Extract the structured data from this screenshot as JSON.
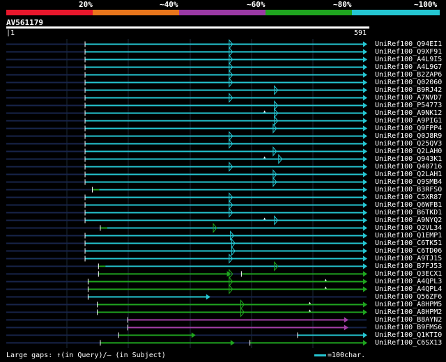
{
  "quality_scale": {
    "labels": [
      "20%",
      "~40%",
      "~60%",
      "~80%",
      "~100%"
    ],
    "colors": [
      "#e8172c",
      "#e8761c",
      "#9b3aa5",
      "#1fa51f",
      "#25c6d2"
    ]
  },
  "query": {
    "accession": "AV561179",
    "start_label": "1",
    "end_label": "591",
    "length": 591
  },
  "hits": [
    {
      "name": "UniRef100_Q94EI1",
      "color": "cyan",
      "segments": [
        [
          130,
          591
        ]
      ],
      "insertions": [
        [
          366,
          "q"
        ]
      ],
      "dots": []
    },
    {
      "name": "UniRef100_Q9XF91",
      "color": "cyan",
      "segments": [
        [
          130,
          591
        ]
      ],
      "insertions": [
        [
          366,
          "q"
        ]
      ],
      "dots": []
    },
    {
      "name": "UniRef100_A4L9I5",
      "color": "cyan",
      "segments": [
        [
          130,
          591
        ]
      ],
      "insertions": [
        [
          366,
          "q"
        ]
      ],
      "dots": []
    },
    {
      "name": "UniRef100_A4L9G7",
      "color": "cyan",
      "segments": [
        [
          130,
          591
        ]
      ],
      "insertions": [
        [
          366,
          "q"
        ]
      ],
      "dots": []
    },
    {
      "name": "UniRef100_B2ZAP6",
      "color": "cyan",
      "segments": [
        [
          130,
          591
        ]
      ],
      "insertions": [
        [
          366,
          "q"
        ]
      ],
      "dots": []
    },
    {
      "name": "UniRef100_Q02060",
      "color": "cyan",
      "segments": [
        [
          130,
          591
        ]
      ],
      "insertions": [
        [
          366,
          "q"
        ]
      ],
      "dots": []
    },
    {
      "name": "UniRef100_B9RJ42",
      "color": "cyan",
      "segments": [
        [
          130,
          591
        ]
      ],
      "insertions": [
        [
          440,
          "q"
        ]
      ],
      "dots": []
    },
    {
      "name": "UniRef100_A7NVD7",
      "color": "cyan",
      "segments": [
        [
          130,
          591
        ]
      ],
      "insertions": [
        [
          366,
          "q"
        ]
      ],
      "dots": []
    },
    {
      "name": "UniRef100_P54773",
      "color": "cyan",
      "segments": [
        [
          130,
          591
        ]
      ],
      "insertions": [
        [
          440,
          "q"
        ]
      ],
      "dots": []
    },
    {
      "name": "UniRef100_A9NK12",
      "color": "cyan",
      "segments": [
        [
          130,
          591
        ]
      ],
      "insertions": [
        [
          440,
          "q"
        ]
      ],
      "dots": [
        [
          424,
          "s"
        ]
      ]
    },
    {
      "name": "UniRef100_A9PIG1",
      "color": "cyan",
      "segments": [
        [
          130,
          591
        ]
      ],
      "insertions": [
        [
          440,
          "q"
        ]
      ],
      "dots": []
    },
    {
      "name": "UniRef100_Q9FPP4",
      "color": "cyan",
      "segments": [
        [
          130,
          591
        ]
      ],
      "insertions": [
        [
          438,
          "q"
        ]
      ],
      "dots": []
    },
    {
      "name": "UniRef100_Q0J8R9",
      "color": "cyan",
      "segments": [
        [
          130,
          591
        ]
      ],
      "insertions": [
        [
          366,
          "q"
        ]
      ],
      "dots": []
    },
    {
      "name": "UniRef100_Q25QV3",
      "color": "cyan",
      "segments": [
        [
          130,
          591
        ]
      ],
      "insertions": [
        [
          366,
          "q"
        ]
      ],
      "dots": []
    },
    {
      "name": "UniRef100_Q2LAH0",
      "color": "cyan",
      "segments": [
        [
          130,
          591
        ]
      ],
      "insertions": [
        [
          438,
          "q"
        ]
      ],
      "dots": []
    },
    {
      "name": "UniRef100_Q943K1",
      "color": "cyan",
      "segments": [
        [
          130,
          591
        ]
      ],
      "insertions": [
        [
          447,
          "q"
        ]
      ],
      "dots": [
        [
          424,
          "s"
        ]
      ]
    },
    {
      "name": "UniRef100_Q40716",
      "color": "cyan",
      "segments": [
        [
          130,
          591
        ]
      ],
      "insertions": [
        [
          366,
          "q"
        ]
      ],
      "dots": []
    },
    {
      "name": "UniRef100_Q2LAH1",
      "color": "cyan",
      "segments": [
        [
          130,
          591
        ]
      ],
      "insertions": [
        [
          438,
          "q"
        ]
      ],
      "dots": []
    },
    {
      "name": "UniRef100_Q9SMB4",
      "color": "cyan",
      "segments": [
        [
          130,
          591
        ]
      ],
      "insertions": [
        [
          438,
          "q"
        ]
      ],
      "dots": []
    },
    {
      "name": "UniRef100_B3RFS0",
      "color": "green_cyan",
      "segments": [
        [
          142,
          591
        ]
      ],
      "insertions": [],
      "dots": []
    },
    {
      "name": "UniRef100_C5XR87",
      "color": "cyan",
      "segments": [
        [
          130,
          591
        ]
      ],
      "insertions": [
        [
          366,
          "q"
        ]
      ],
      "dots": []
    },
    {
      "name": "UniRef100_Q6WFB1",
      "color": "cyan",
      "segments": [
        [
          130,
          591
        ]
      ],
      "insertions": [
        [
          366,
          "q"
        ]
      ],
      "dots": []
    },
    {
      "name": "UniRef100_B6TKD1",
      "color": "cyan",
      "segments": [
        [
          130,
          591
        ]
      ],
      "insertions": [
        [
          366,
          "q"
        ]
      ],
      "dots": []
    },
    {
      "name": "UniRef100_A9NYQ2",
      "color": "cyan",
      "segments": [
        [
          130,
          591
        ]
      ],
      "insertions": [
        [
          440,
          "q"
        ]
      ],
      "dots": [
        [
          424,
          "s"
        ]
      ]
    },
    {
      "name": "UniRef100_Q2VL34",
      "color": "green_cyan",
      "segments": [
        [
          155,
          591
        ]
      ],
      "insertions": [
        [
          340,
          "q"
        ]
      ],
      "dots": []
    },
    {
      "name": "UniRef100_Q1EMP1",
      "color": "cyan",
      "segments": [
        [
          130,
          591
        ]
      ],
      "insertions": [
        [
          368,
          "q"
        ]
      ],
      "dots": []
    },
    {
      "name": "UniRef100_C6TK51",
      "color": "cyan",
      "segments": [
        [
          130,
          591
        ]
      ],
      "insertions": [
        [
          370,
          "q"
        ]
      ],
      "dots": []
    },
    {
      "name": "UniRef100_C6TD06",
      "color": "cyan",
      "segments": [
        [
          130,
          591
        ]
      ],
      "insertions": [
        [
          370,
          "q"
        ]
      ],
      "dots": []
    },
    {
      "name": "UniRef100_A9TJ15",
      "color": "cyan",
      "segments": [
        [
          130,
          591
        ]
      ],
      "insertions": [
        [
          366,
          "q"
        ]
      ],
      "dots": []
    },
    {
      "name": "UniRef100_B7FJ53",
      "color": "green_cyan",
      "segments": [
        [
          152,
          591
        ]
      ],
      "insertions": [
        [
          440,
          "q"
        ]
      ],
      "dots": []
    },
    {
      "name": "UniRef100_Q3ECX1",
      "color": "green",
      "segments": [
        [
          152,
          368
        ],
        [
          386,
          591
        ]
      ],
      "insertions": [
        [
          366,
          "q"
        ]
      ],
      "dots": []
    },
    {
      "name": "UniRef100_A4QPL3",
      "color": "green",
      "segments": [
        [
          135,
          591
        ]
      ],
      "insertions": [
        [
          366,
          "q"
        ]
      ],
      "dots": [
        [
          524,
          "s"
        ]
      ]
    },
    {
      "name": "UniRef100_A4QPL4",
      "color": "green",
      "segments": [
        [
          135,
          591
        ]
      ],
      "insertions": [
        [
          366,
          "q"
        ]
      ],
      "dots": [
        [
          524,
          "s"
        ]
      ]
    },
    {
      "name": "UniRef100_Q56ZF6",
      "color": "cyan",
      "segments": [
        [
          135,
          334
        ]
      ],
      "insertions": [],
      "dots": []
    },
    {
      "name": "UniRef100_A8HPM5",
      "color": "green",
      "segments": [
        [
          150,
          591
        ]
      ],
      "insertions": [
        [
          385,
          "q"
        ]
      ],
      "dots": [
        [
          498,
          "s"
        ]
      ]
    },
    {
      "name": "UniRef100_A8HPM2",
      "color": "green",
      "segments": [
        [
          150,
          591
        ]
      ],
      "insertions": [
        [
          385,
          "q"
        ]
      ],
      "dots": [
        [
          498,
          "s"
        ]
      ]
    },
    {
      "name": "UniRef100_B8AYN2",
      "color": "purple",
      "segments": [
        [
          200,
          560
        ]
      ],
      "insertions": [],
      "dots": []
    },
    {
      "name": "UniRef100_B9FMS6",
      "color": "purple",
      "segments": [
        [
          200,
          560
        ]
      ],
      "insertions": [],
      "dots": []
    },
    {
      "name": "UniRef100_Q1KTI0",
      "color": "cyan_green",
      "segments": [
        [
          185,
          310
        ],
        [
          478,
          591
        ]
      ],
      "insertions": [],
      "dots": []
    },
    {
      "name": "UniRef100_C6SX13",
      "color": "green",
      "segments": [
        [
          155,
          374
        ],
        [
          400,
          591
        ]
      ],
      "insertions": [],
      "dots": []
    }
  ],
  "footer": {
    "text": "Large gaps: ↑(in Query)/— (in Subject)",
    "legend": "=100char."
  }
}
